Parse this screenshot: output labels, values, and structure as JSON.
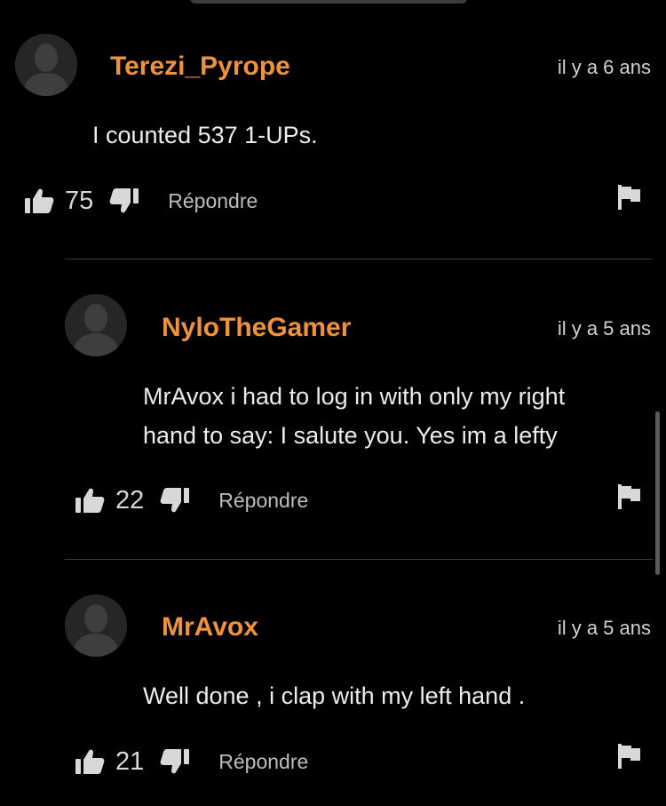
{
  "comments": [
    {
      "username": "Terezi_Pyrope",
      "timestamp": "il y a 6 ans",
      "lines": [
        "I counted 537 1-UPs."
      ],
      "likes": "75",
      "reply_label": "Répondre"
    },
    {
      "username": "NyloTheGamer",
      "timestamp": "il y a 5 ans",
      "lines": [
        "MrAvox i had to log in with only my right",
        "hand to say: I salute you. Yes im a lefty"
      ],
      "likes": "22",
      "reply_label": "Répondre"
    },
    {
      "username": "MrAvox",
      "timestamp": "il y a 5 ans",
      "lines": [
        "Well done , i clap with my left hand ."
      ],
      "likes": "21",
      "reply_label": "Répondre"
    }
  ],
  "colors": {
    "background": "#000000",
    "username": "#f0923a",
    "text": "#ececec",
    "muted": "#bdbdbd",
    "divider": "#3a3a3a",
    "avatar": "#262626"
  },
  "icons": {
    "like": "thumbs-up-icon",
    "dislike": "thumbs-down-icon",
    "report": "flag-icon",
    "avatar": "default-user-avatar-icon"
  }
}
